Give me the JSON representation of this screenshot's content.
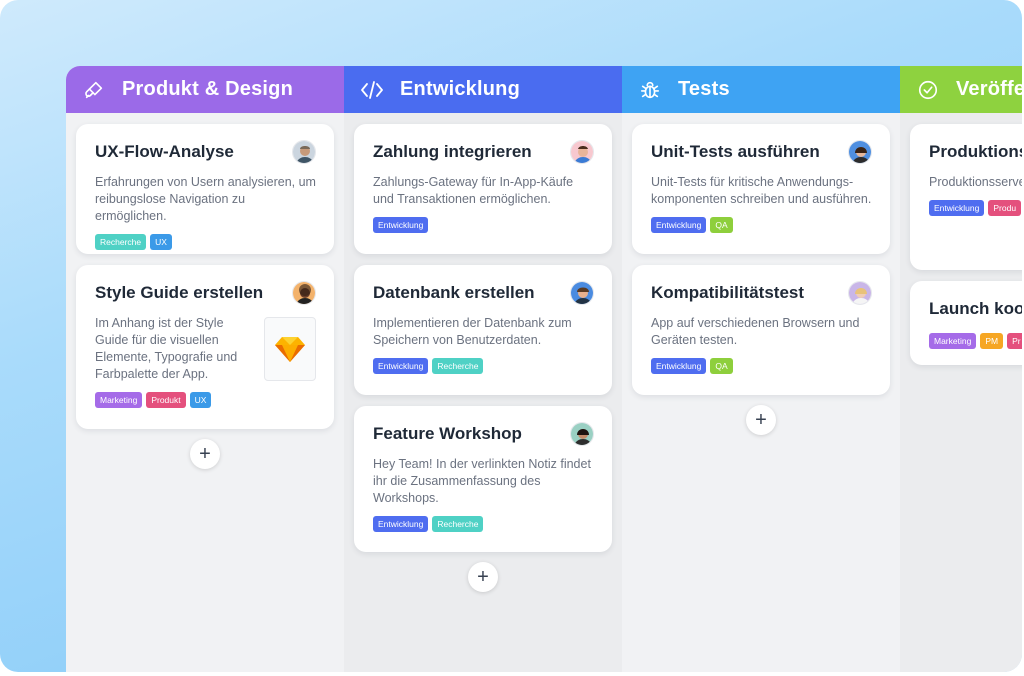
{
  "columns": [
    {
      "title": "Produkt & Design",
      "icon": "pen-brush-icon",
      "color": "#9b6ae8",
      "cards": [
        {
          "title": "UX-Flow-Analyse",
          "desc": "Erfahrungen von Usern analysieren, um reibungslose Navigation zu ermöglichen.",
          "tags": [
            "Recherche",
            "UX"
          ]
        },
        {
          "title": "Style Guide erstellen",
          "desc": "Im Anhang ist der Style Guide für die visuellen Elemente, Typografie und Farbpalette der App.",
          "tags": [
            "Marketing",
            "Produkt",
            "UX"
          ]
        }
      ]
    },
    {
      "title": "Entwicklung",
      "icon": "code-icon",
      "color": "#4a6cf0",
      "cards": [
        {
          "title": "Zahlung integrieren",
          "desc": "Zahlungs-Gateway für In-App-Käufe und Transaktionen ermöglichen.",
          "tags": [
            "Entwicklung"
          ]
        },
        {
          "title": "Datenbank erstellen",
          "desc": "Implementieren der Datenbank zum Speichern von Benutzerdaten.",
          "tags": [
            "Entwicklung",
            "Recherche"
          ]
        },
        {
          "title": "Feature Workshop",
          "desc": "Hey Team! In der verlinkten Notiz findet ihr die Zusammenfassung des Workshops.",
          "tags": [
            "Entwicklung",
            "Recherche"
          ]
        }
      ]
    },
    {
      "title": "Tests",
      "icon": "bug-icon",
      "color": "#3ea3f3",
      "cards": [
        {
          "title": "Unit-Tests ausführen",
          "desc": "Unit-Tests für kritische Anwendungs-komponenten schreiben und ausführen.",
          "tags": [
            "Entwicklung",
            "QA"
          ]
        },
        {
          "title": "Kompatibilitätstest",
          "desc": "App auf verschiedenen Browsern und Geräten testen.",
          "tags": [
            "Entwicklung",
            "QA"
          ]
        }
      ]
    },
    {
      "title": "Veröffe",
      "icon": "check-circle-icon",
      "color": "#8ed23f",
      "cards": [
        {
          "title": "Produktions aufsetzen",
          "desc": "Produktionsserve Anwendung konf",
          "tags": [
            "Entwicklung",
            "Produ"
          ]
        },
        {
          "title": "Launch koor",
          "tags": [
            "Marketing",
            "PM",
            "Pr"
          ]
        }
      ]
    }
  ],
  "add_label": "+"
}
